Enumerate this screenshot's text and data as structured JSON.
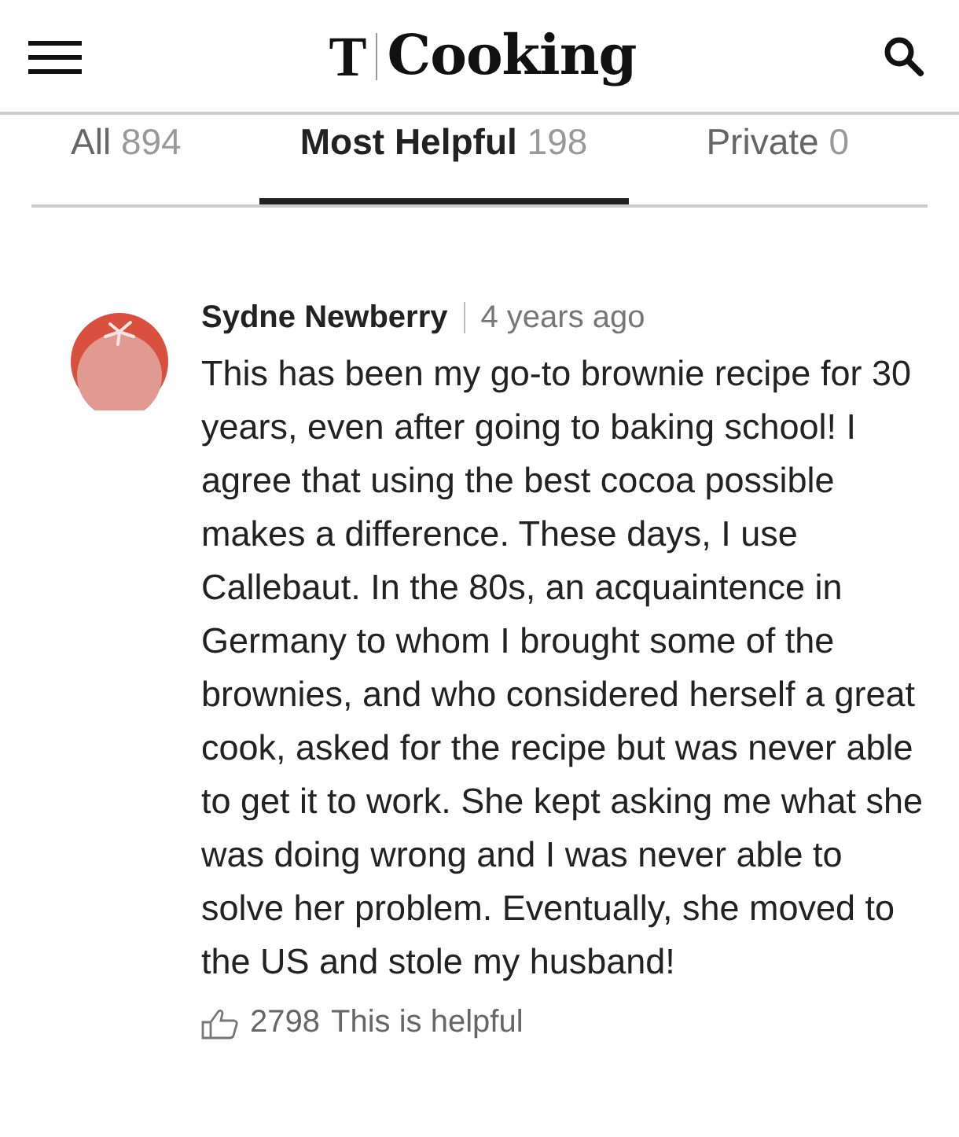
{
  "header": {
    "logo_mark": "T",
    "title": "Cooking"
  },
  "tabs": [
    {
      "label": "All",
      "count": "894",
      "selected": false
    },
    {
      "label": "Most Helpful",
      "count": "198",
      "selected": true
    },
    {
      "label": "Private",
      "count": "0",
      "selected": false
    }
  ],
  "comments": [
    {
      "author": "Sydne Newberry",
      "time": "4 years ago",
      "text": "This has been my go-to brownie recipe for 30 years, even after going to baking school! I agree that using the best cocoa possible makes a difference. These days, I use Callebaut. In the 80s, an acquaintence in Germany to whom I brought some of the brownies, and who considered herself a great cook, asked for the recipe but was never able to get it to work. She kept asking me what she was doing wrong and I was never able to solve her problem. Eventually, she moved to the US and stole my husband!",
      "helpful_count": "2798",
      "helpful_label": "This is helpful"
    }
  ]
}
